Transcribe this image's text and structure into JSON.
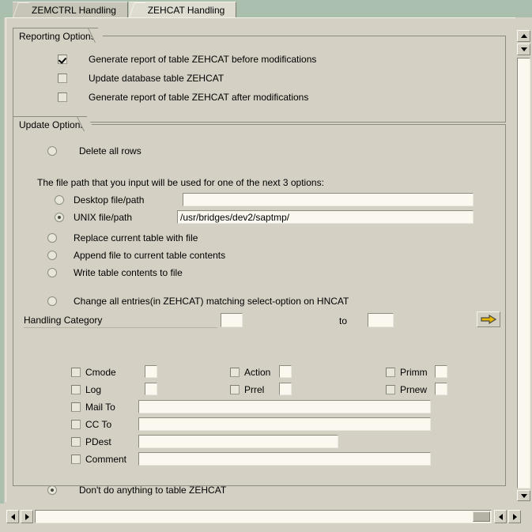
{
  "tabs": [
    {
      "label": "ZEMCTRL Handling",
      "active": false
    },
    {
      "label": "ZEHCAT Handling",
      "active": true
    }
  ],
  "reporting_options": {
    "title": "Reporting Options",
    "items": [
      {
        "label": "Generate report of table ZEHCAT before modifications",
        "checked": true
      },
      {
        "label": "Update database table ZEHCAT",
        "checked": false
      },
      {
        "label": "Generate report of table ZEHCAT after modifications",
        "checked": false
      }
    ]
  },
  "update_options": {
    "title": "Update Options",
    "delete_all_rows": {
      "label": "Delete all rows",
      "selected": false
    },
    "file_path_note": "The file path that you input will be used for one of the next 3 options:",
    "desktop": {
      "label": "Desktop file/path",
      "selected": false,
      "value": "",
      "placeholder": ""
    },
    "unix": {
      "label": "UNIX file/path",
      "selected": true,
      "value": "/usr/bridges/dev2/saptmp/",
      "placeholder": ""
    },
    "file_actions": [
      {
        "label": "Replace current table with file",
        "selected": false
      },
      {
        "label": "Append file to current table contents",
        "selected": false
      },
      {
        "label": "Write table contents to file",
        "selected": false
      }
    ],
    "change_entries": {
      "label": "Change all entries(in ZEHCAT) matching select-option on HNCAT",
      "selected": false
    },
    "handling_category": {
      "label": "Handling Category",
      "from_value": "",
      "to_label": "to",
      "to_value": "",
      "execute_icon": "right-arrow-icon"
    },
    "field_grid": [
      [
        {
          "label": "Cmode",
          "checked": false,
          "value": ""
        },
        {
          "label": "Action",
          "checked": false,
          "value": ""
        },
        {
          "label": "Primm",
          "checked": false,
          "value": ""
        }
      ],
      [
        {
          "label": "Log",
          "checked": false,
          "value": ""
        },
        {
          "label": "Prrel",
          "checked": false,
          "value": ""
        },
        {
          "label": "Prnew",
          "checked": false,
          "value": ""
        }
      ]
    ],
    "long_fields": [
      {
        "label": "Mail To",
        "checked": false,
        "value": ""
      },
      {
        "label": "CC To",
        "checked": false,
        "value": ""
      },
      {
        "label": "PDest",
        "checked": false,
        "value": ""
      },
      {
        "label": "Comment",
        "checked": false,
        "value": ""
      }
    ],
    "do_nothing": {
      "label": "Don't do anything to table ZEHCAT",
      "selected": true
    }
  },
  "scrollbars": {
    "vertical_up": "scroll-up-icon",
    "vertical_down": "scroll-down-icon",
    "bottom_down": "scroll-down-icon",
    "h_left": "scroll-left-icon",
    "h_right": "scroll-right-icon",
    "h_left2": "scroll-left-icon",
    "h_right2": "scroll-right-icon"
  },
  "colors": {
    "window_bg": "#d4d0c4",
    "tab_strip": "#aabfae",
    "input_bg": "#fbf9ef",
    "accent_arrow": "#e8b900"
  }
}
